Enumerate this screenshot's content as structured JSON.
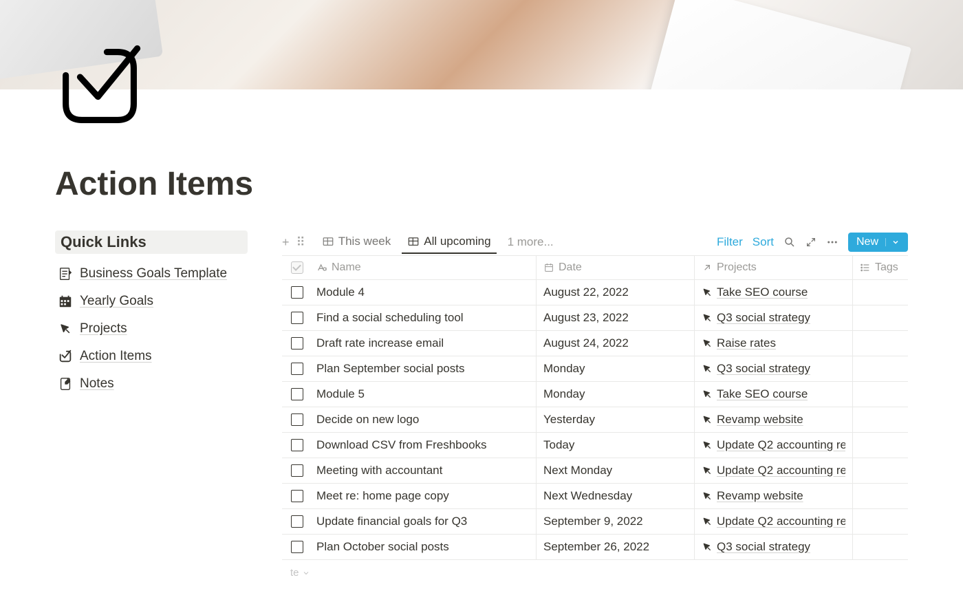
{
  "page": {
    "title": "Action Items"
  },
  "sidebar": {
    "header": "Quick Links",
    "items": [
      {
        "label": "Business Goals Template",
        "icon": "goals"
      },
      {
        "label": "Yearly Goals",
        "icon": "calendar"
      },
      {
        "label": "Projects",
        "icon": "click"
      },
      {
        "label": "Action Items",
        "icon": "check"
      },
      {
        "label": "Notes",
        "icon": "note"
      }
    ]
  },
  "views": {
    "tabs": [
      {
        "label": "This week",
        "active": false
      },
      {
        "label": "All upcoming",
        "active": true
      }
    ],
    "more": "1 more...",
    "actions": {
      "filter": "Filter",
      "sort": "Sort",
      "new": "New"
    }
  },
  "table": {
    "columns": {
      "name": "Name",
      "date": "Date",
      "projects": "Projects",
      "tags": "Tags"
    },
    "rows": [
      {
        "name": "Module 4",
        "date": "August 22, 2022",
        "project": "Take SEO course"
      },
      {
        "name": "Find a social scheduling tool",
        "date": "August 23, 2022",
        "project": "Q3 social strategy"
      },
      {
        "name": "Draft rate increase email",
        "date": "August 24, 2022",
        "project": "Raise rates"
      },
      {
        "name": "Plan September social posts",
        "date": "Monday",
        "project": "Q3 social strategy"
      },
      {
        "name": "Module 5",
        "date": "Monday",
        "project": "Take SEO course"
      },
      {
        "name": "Decide on new logo",
        "date": "Yesterday",
        "project": "Revamp website"
      },
      {
        "name": "Download CSV from Freshbooks",
        "date": "Today",
        "project": "Update Q2 accounting re"
      },
      {
        "name": "Meeting with accountant",
        "date": "Next Monday",
        "project": "Update Q2 accounting re"
      },
      {
        "name": "Meet re: home page copy",
        "date": "Next Wednesday",
        "project": "Revamp website"
      },
      {
        "name": "Update financial goals for Q3",
        "date": "September 9, 2022",
        "project": "Update Q2 accounting re"
      },
      {
        "name": "Plan October social posts",
        "date": "September 26, 2022",
        "project": "Q3 social strategy"
      }
    ],
    "footer": "te"
  }
}
